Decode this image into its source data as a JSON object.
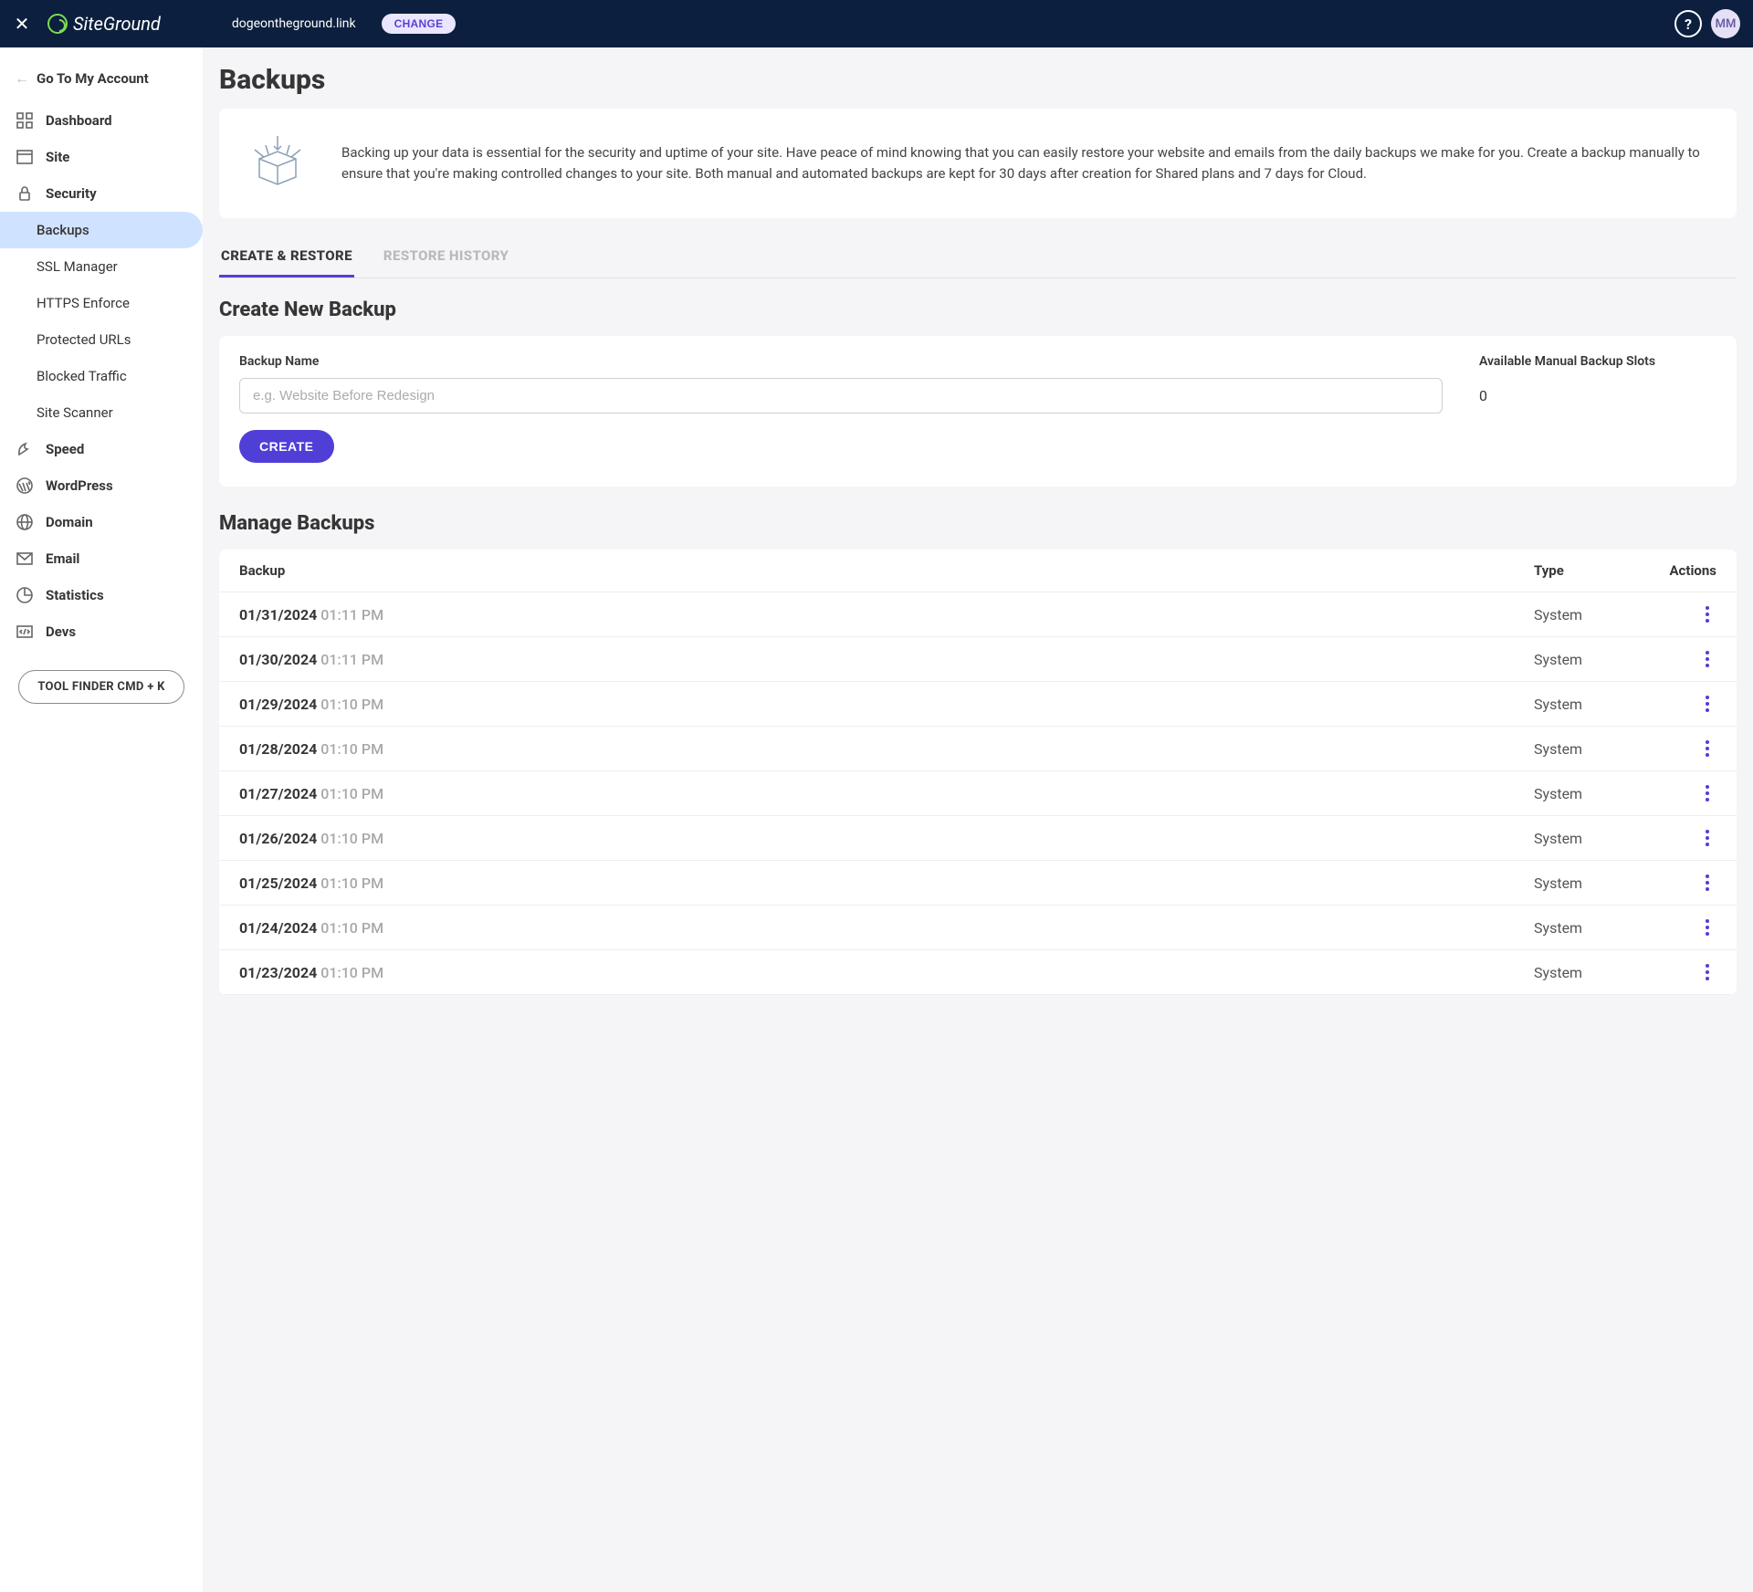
{
  "topbar": {
    "domain": "dogeontheground.link",
    "change": "CHANGE",
    "logo_text": "SiteGround",
    "avatar": "MM",
    "help": "?"
  },
  "sidebar": {
    "back": "Go To My Account",
    "items": [
      {
        "label": "Dashboard",
        "icon": "dashboard-icon"
      },
      {
        "label": "Site",
        "icon": "site-icon"
      },
      {
        "label": "Security",
        "icon": "security-icon"
      },
      {
        "label": "Speed",
        "icon": "speed-icon"
      },
      {
        "label": "WordPress",
        "icon": "wordpress-icon"
      },
      {
        "label": "Domain",
        "icon": "domain-icon"
      },
      {
        "label": "Email",
        "icon": "email-icon"
      },
      {
        "label": "Statistics",
        "icon": "statistics-icon"
      },
      {
        "label": "Devs",
        "icon": "devs-icon"
      }
    ],
    "security_subs": [
      "Backups",
      "SSL Manager",
      "HTTPS Enforce",
      "Protected URLs",
      "Blocked Traffic",
      "Site Scanner"
    ],
    "tool_finder": "TOOL FINDER CMD + K"
  },
  "page": {
    "title": "Backups",
    "intro": "Backing up your data is essential for the security and uptime of your site. Have peace of mind knowing that you can easily restore your website and emails from the daily backups we make for you. Create a backup manually to ensure that you're making controlled changes to your site. Both manual and automated backups are kept for 30 days after creation for Shared plans and 7 days for Cloud.",
    "tabs": [
      "CREATE & RESTORE",
      "RESTORE HISTORY"
    ],
    "create": {
      "heading": "Create New Backup",
      "name_label": "Backup Name",
      "name_placeholder": "e.g. Website Before Redesign",
      "slots_label": "Available Manual Backup Slots",
      "slots_value": "0",
      "button": "CREATE"
    },
    "manage": {
      "heading": "Manage Backups",
      "cols": [
        "Backup",
        "Type",
        "Actions"
      ],
      "rows": [
        {
          "date": "01/31/2024",
          "time": "01:11 PM",
          "type": "System"
        },
        {
          "date": "01/30/2024",
          "time": "01:11 PM",
          "type": "System"
        },
        {
          "date": "01/29/2024",
          "time": "01:10 PM",
          "type": "System"
        },
        {
          "date": "01/28/2024",
          "time": "01:10 PM",
          "type": "System"
        },
        {
          "date": "01/27/2024",
          "time": "01:10 PM",
          "type": "System"
        },
        {
          "date": "01/26/2024",
          "time": "01:10 PM",
          "type": "System"
        },
        {
          "date": "01/25/2024",
          "time": "01:10 PM",
          "type": "System"
        },
        {
          "date": "01/24/2024",
          "time": "01:10 PM",
          "type": "System"
        },
        {
          "date": "01/23/2024",
          "time": "01:10 PM",
          "type": "System"
        }
      ]
    }
  }
}
